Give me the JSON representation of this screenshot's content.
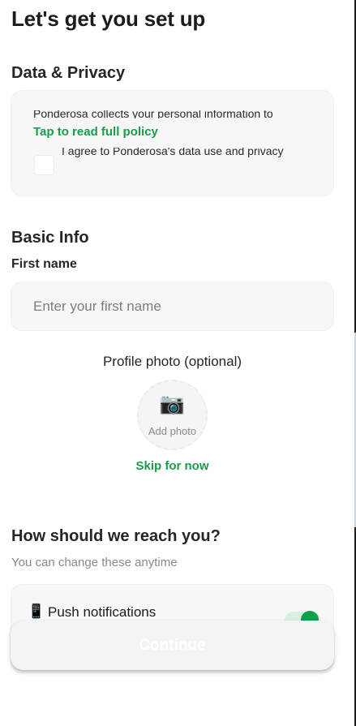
{
  "page": {
    "title": "Let's get you set up"
  },
  "privacy": {
    "heading": "Data & Privacy",
    "policy_snippet": "Ponderosa collects your personal information to",
    "read_policy_link": "Tap to read full policy",
    "agree_text": "I agree to Ponderosa's data use and privacy",
    "agree_checked": false
  },
  "basic_info": {
    "heading": "Basic Info",
    "first_name_label": "First name",
    "first_name_placeholder": "Enter your first name",
    "first_name_value": ""
  },
  "photo": {
    "label": "Profile photo (optional)",
    "camera_icon": "📷",
    "add_photo_label": "Add photo",
    "skip_label": "Skip for now"
  },
  "contact": {
    "heading": "How should we reach you?",
    "subtitle": "You can change these anytime",
    "push": {
      "icon": "📱",
      "label": "Push notifications",
      "enabled": true
    }
  },
  "actions": {
    "continue_label": "Continue",
    "continue_disabled": true
  },
  "colors": {
    "accent": "#1a9c4b",
    "toggle_on": "#12a04d",
    "card_bg": "#f7f7f7",
    "text": "#1c1c1c",
    "muted": "#8a8a8a"
  }
}
